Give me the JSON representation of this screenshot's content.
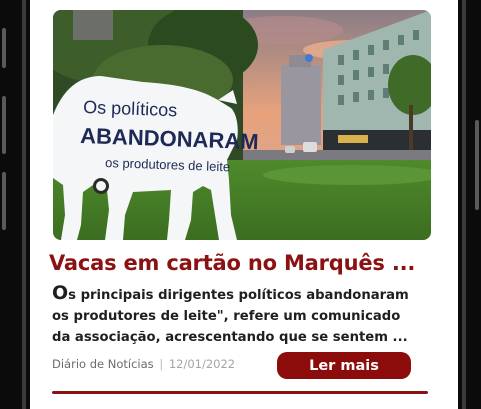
{
  "article": {
    "image_alt": "",
    "sign_line1": "Os políticos",
    "sign_line2": "ABANDONARAM",
    "sign_line3": "os produtores de leite",
    "headline": "Vacas em cartão no Marquês ...",
    "excerpt_dropcap": "O",
    "excerpt_rest": "s principais dirigentes políticos abandonaram os produtores de leite\", refere um comunicado da associação, acrescentando que se sentem ...",
    "source": "Diário de Notícias",
    "separator": "|",
    "date": "12/01/2022",
    "read_more_label": "Ler mais"
  },
  "colors": {
    "accent": "#8b1212",
    "button": "#8c0c0c",
    "text": "#1f1f1f",
    "meta": "#6b6b6b"
  }
}
